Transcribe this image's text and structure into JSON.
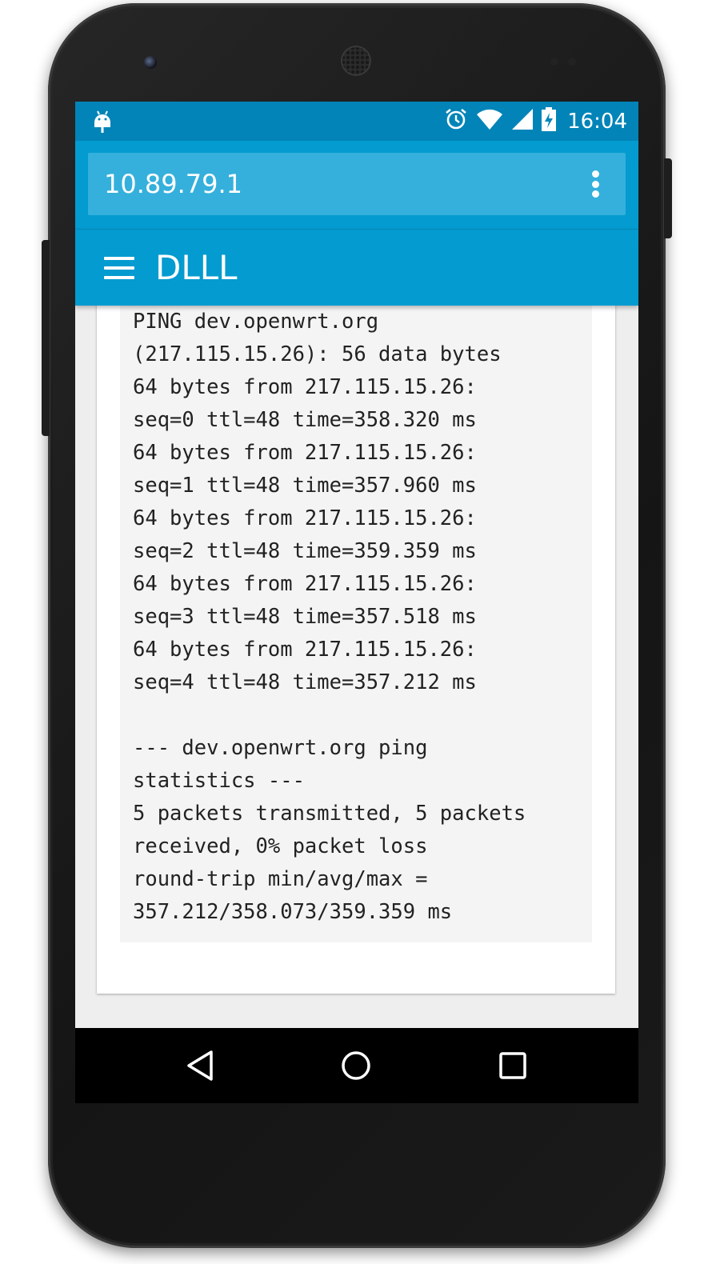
{
  "status_bar": {
    "time": "16:04",
    "icons": [
      "android-icon",
      "alarm-icon",
      "wifi-icon",
      "signal-icon",
      "battery-charging-icon"
    ]
  },
  "toolbar": {
    "address": "10.89.79.1",
    "overflow_icon": "more-vert-icon"
  },
  "appbar": {
    "menu_icon": "hamburger-menu-icon",
    "title": "DLLL"
  },
  "ping_output": {
    "lines": [
      "PING dev.openwrt.org",
      "(217.115.15.26): 56 data bytes",
      "64 bytes from 217.115.15.26:",
      "seq=0 ttl=48 time=358.320 ms",
      "64 bytes from 217.115.15.26:",
      "seq=1 ttl=48 time=357.960 ms",
      "64 bytes from 217.115.15.26:",
      "seq=2 ttl=48 time=359.359 ms",
      "64 bytes from 217.115.15.26:",
      "seq=3 ttl=48 time=357.518 ms",
      "64 bytes from 217.115.15.26:",
      "seq=4 ttl=48 time=357.212 ms",
      "",
      "--- dev.openwrt.org ping",
      "statistics ---",
      "5 packets transmitted, 5 packets",
      "received, 0% packet loss",
      "round-trip min/avg/max =",
      "357.212/358.073/359.359 ms"
    ]
  },
  "navbar": {
    "icons": [
      "back-icon",
      "home-icon",
      "recent-apps-icon"
    ]
  },
  "colors": {
    "status_bar": "#0284b8",
    "primary": "#039bd0",
    "address_box": "#35b0dc",
    "output_bg": "#f4f4f4",
    "page_bg": "#eeeeee"
  }
}
